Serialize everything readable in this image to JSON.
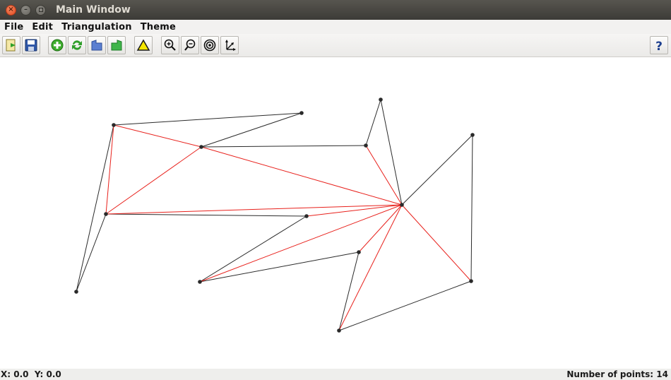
{
  "window": {
    "title": "Main Window"
  },
  "menu": {
    "items": [
      "File",
      "Edit",
      "Triangulation",
      "Theme"
    ]
  },
  "toolbar": {
    "buttons": [
      {
        "icon": "open-file-icon"
      },
      {
        "icon": "save-icon"
      },
      {
        "icon": "add-point-icon"
      },
      {
        "icon": "refresh-icon"
      },
      {
        "icon": "undo-icon"
      },
      {
        "icon": "redo-icon"
      },
      {
        "icon": "triangle-icon"
      },
      {
        "icon": "zoom-in-icon"
      },
      {
        "icon": "zoom-out-icon"
      },
      {
        "icon": "target-icon"
      },
      {
        "icon": "move-axes-icon"
      },
      {
        "icon": "help-icon"
      }
    ]
  },
  "status": {
    "x_label": "X:",
    "x_value": "0.0",
    "y_label": "Y:",
    "y_value": "0.0",
    "points_label": "Number of points:",
    "points_value": "14"
  },
  "colors": {
    "black_edge": "#2b2b2b",
    "red_edge": "#e8201b",
    "point": "#2a2a2a"
  },
  "graph": {
    "points": [
      [
        161,
        177
      ],
      [
        427,
        160
      ],
      [
        285,
        208
      ],
      [
        539,
        141
      ],
      [
        518,
        206
      ],
      [
        669,
        191
      ],
      [
        150,
        303
      ],
      [
        569,
        290
      ],
      [
        434,
        306
      ],
      [
        108,
        413
      ],
      [
        283,
        399
      ],
      [
        508,
        357
      ],
      [
        667,
        398
      ],
      [
        480,
        468
      ]
    ],
    "black_edges": [
      [
        0,
        1
      ],
      [
        1,
        2
      ],
      [
        2,
        4
      ],
      [
        4,
        3
      ],
      [
        3,
        7
      ],
      [
        7,
        5
      ],
      [
        5,
        12
      ],
      [
        12,
        13
      ],
      [
        13,
        11
      ],
      [
        11,
        10
      ],
      [
        10,
        8
      ],
      [
        8,
        6
      ],
      [
        6,
        9
      ],
      [
        9,
        0
      ]
    ],
    "red_edges": [
      [
        0,
        2
      ],
      [
        0,
        6
      ],
      [
        2,
        6
      ],
      [
        2,
        7
      ],
      [
        4,
        7
      ],
      [
        6,
        7
      ],
      [
        8,
        7
      ],
      [
        10,
        7
      ],
      [
        11,
        7
      ],
      [
        13,
        7
      ],
      [
        12,
        7
      ]
    ]
  }
}
